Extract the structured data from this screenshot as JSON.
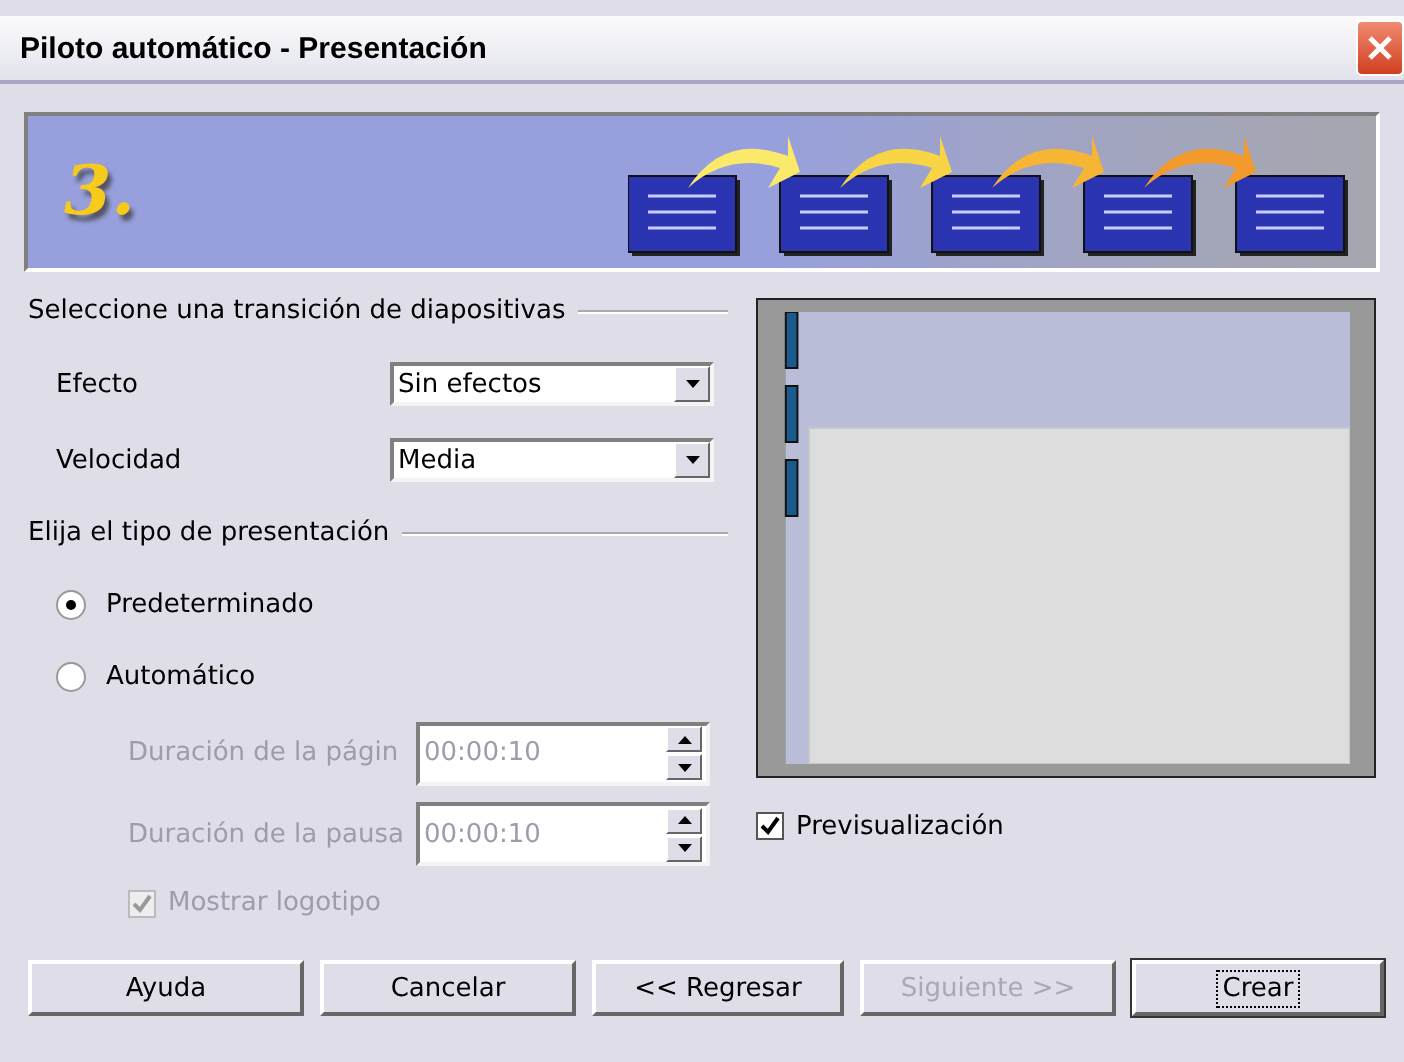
{
  "window": {
    "title": "Piloto automático - Presentación"
  },
  "banner": {
    "step": "3."
  },
  "transition": {
    "heading": "Seleccione una transición de diapositivas",
    "fields": [
      {
        "label": "Efecto",
        "value": "Sin efectos"
      },
      {
        "label": "Velocidad",
        "value": "Media"
      }
    ]
  },
  "presentation_type": {
    "heading": "Elija el tipo de presentación",
    "options": [
      {
        "label": "Predeterminado",
        "selected": true
      },
      {
        "label": "Automático",
        "selected": false
      }
    ],
    "durations": [
      {
        "label": "Duración de la págin",
        "value": "00:00:10",
        "disabled": true
      },
      {
        "label": "Duración de la pausa",
        "value": "00:00:10",
        "disabled": true
      }
    ],
    "logo": {
      "label": "Mostrar logotipo",
      "checked": true,
      "disabled": true
    }
  },
  "preview": {
    "label": "Previsualización",
    "checked": true
  },
  "buttons": [
    {
      "label": "Ayuda",
      "disabled": false,
      "focused": false
    },
    {
      "label": "Cancelar",
      "disabled": false,
      "focused": false
    },
    {
      "label": "<< Regresar",
      "disabled": false,
      "focused": false
    },
    {
      "label": "Siguiente >>",
      "disabled": true,
      "focused": false
    },
    {
      "label": "Crear",
      "disabled": false,
      "focused": true
    }
  ]
}
